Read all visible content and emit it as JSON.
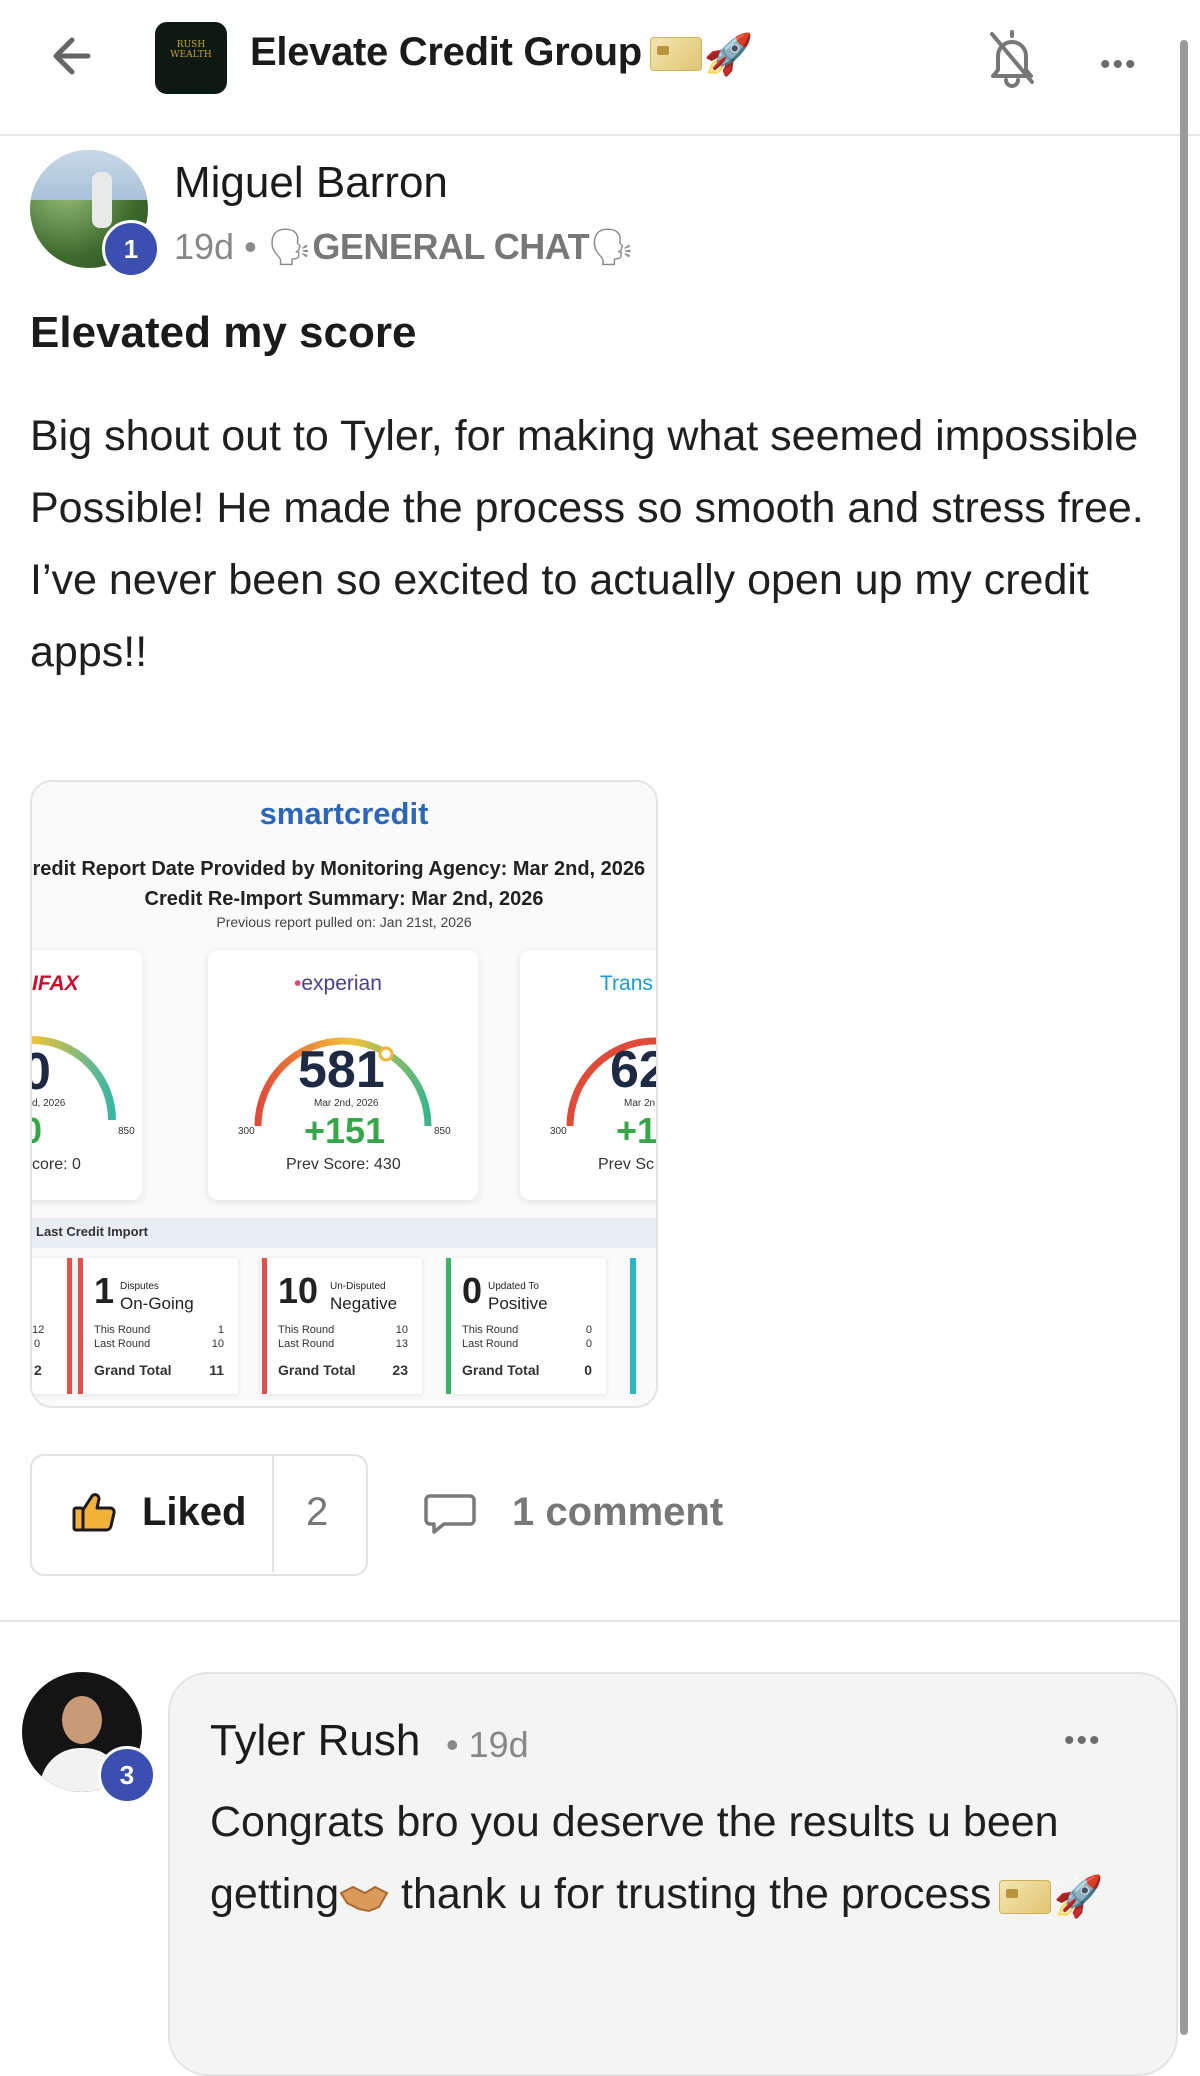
{
  "header": {
    "group_name": "Elevate Credit Group",
    "logo_text": "RUSH WEALTH",
    "back_icon": "arrow-left-icon",
    "bell_icon": "bell-off-icon",
    "more_icon": "more-horizontal-icon",
    "more_label": "•••"
  },
  "post": {
    "author": "Miguel Barron",
    "author_level": "1",
    "time": "19d",
    "separator": "•",
    "category": "GENERAL CHAT",
    "title": "Elevated my score",
    "body": "Big shout out to Tyler, for making what seemed impossible Possible! He made the process so smooth and stress free. I’ve never been so excited to actually open up my credit apps!!"
  },
  "image": {
    "brand": "smartcredit",
    "line1": "Credit Report Date Provided by Monitoring Agency: Mar 2nd, 2026",
    "line2": "Credit Re-Import Summary: Mar 2nd, 2026",
    "line3": "Previous report pulled on: Jan 21st, 2026",
    "bureaus": [
      {
        "name": "IFAX",
        "score": "0",
        "date": "d, 2026",
        "min": "",
        "max": "850",
        "delta": "0",
        "prev": "core: 0"
      },
      {
        "name": "experian",
        "score": "581",
        "date": "Mar 2nd, 2026",
        "min": "300",
        "max": "850",
        "delta": "+151",
        "prev": "Prev Score: 430"
      },
      {
        "name": "Trans",
        "score": "62",
        "date": "Mar 2n",
        "min": "300",
        "max": "",
        "delta": "+1",
        "prev": "Prev Sc"
      }
    ],
    "band_title": "Last Credit Import",
    "stats": [
      {
        "num": "1",
        "small": "Disputes",
        "label": "On-Going",
        "this_round": "1",
        "last_round": "10",
        "grand_total": "11",
        "color": "#e0524b"
      },
      {
        "num": "10",
        "small": "Un-Disputed",
        "label": "Negative",
        "this_round": "10",
        "last_round": "13",
        "grand_total": "23",
        "color": "#e0524b"
      },
      {
        "num": "0",
        "small": "Updated To",
        "label": "Positive",
        "this_round": "0",
        "last_round": "0",
        "grand_total": "0",
        "color": "#3bb36a"
      }
    ],
    "left_partial": {
      "this_round": "12",
      "last_round": "0",
      "grand_total": "2"
    },
    "row_labels": {
      "this_round": "This Round",
      "last_round": "Last Round",
      "grand_total": "Grand Total"
    }
  },
  "actions": {
    "like_label": "Liked",
    "like_count": "2",
    "comment_label": "1 comment",
    "like_icon": "thumbs-up-icon",
    "comment_icon": "comment-icon"
  },
  "comment": {
    "author": "Tyler Rush",
    "author_level": "3",
    "time": "• 19d",
    "more_label": "•••",
    "body_part1": "Congrats bro you deserve the results u been getting",
    "body_part2": " thank u for trusting the process"
  }
}
